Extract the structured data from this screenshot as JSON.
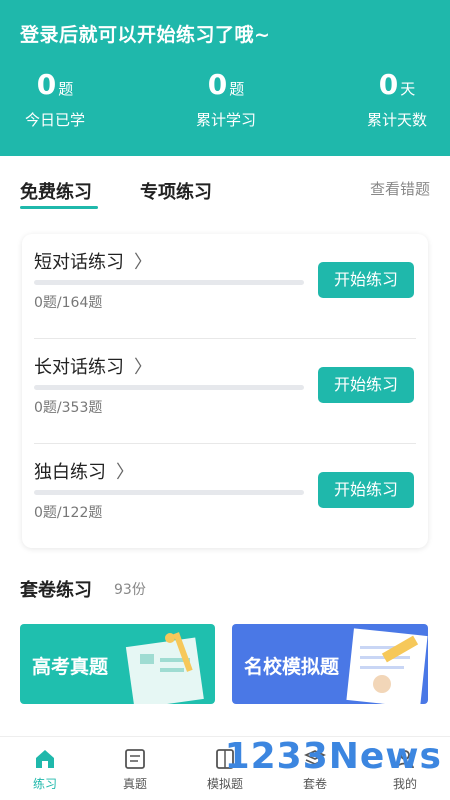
{
  "header": {
    "title": "登录后就可以开始练习了哦~",
    "stats": [
      {
        "value": "0",
        "unit": "题",
        "label": "今日已学"
      },
      {
        "value": "0",
        "unit": "题",
        "label": "累计学习"
      },
      {
        "value": "0",
        "unit": "天",
        "label": "累计天数"
      }
    ]
  },
  "tabs": {
    "free": "免费练习",
    "special": "专项练习",
    "view_wrong": "查看错题"
  },
  "exercises": [
    {
      "name": "短对话练习",
      "chevron": "〉",
      "count": "0题/164题",
      "button": "开始练习"
    },
    {
      "name": "长对话练习",
      "chevron": "〉",
      "count": "0题/353题",
      "button": "开始练习"
    },
    {
      "name": "独白练习",
      "chevron": "〉",
      "count": "0题/122题",
      "button": "开始练习"
    }
  ],
  "papers": {
    "title": "套卷练习",
    "count": "93份",
    "banners": [
      {
        "label": "高考真题",
        "color": "#1fbfae"
      },
      {
        "label": "名校模拟题",
        "color": "#4a78e6"
      }
    ]
  },
  "tabbar": {
    "items": [
      {
        "label": "练习",
        "icon": "home-icon"
      },
      {
        "label": "真题",
        "icon": "exam-paper-icon"
      },
      {
        "label": "模拟题",
        "icon": "mock-icon"
      },
      {
        "label": "套卷",
        "icon": "stack-icon"
      },
      {
        "label": "我的",
        "icon": "user-icon"
      }
    ]
  },
  "watermark": "1233News",
  "colors": {
    "accent": "#1fb8ab"
  }
}
